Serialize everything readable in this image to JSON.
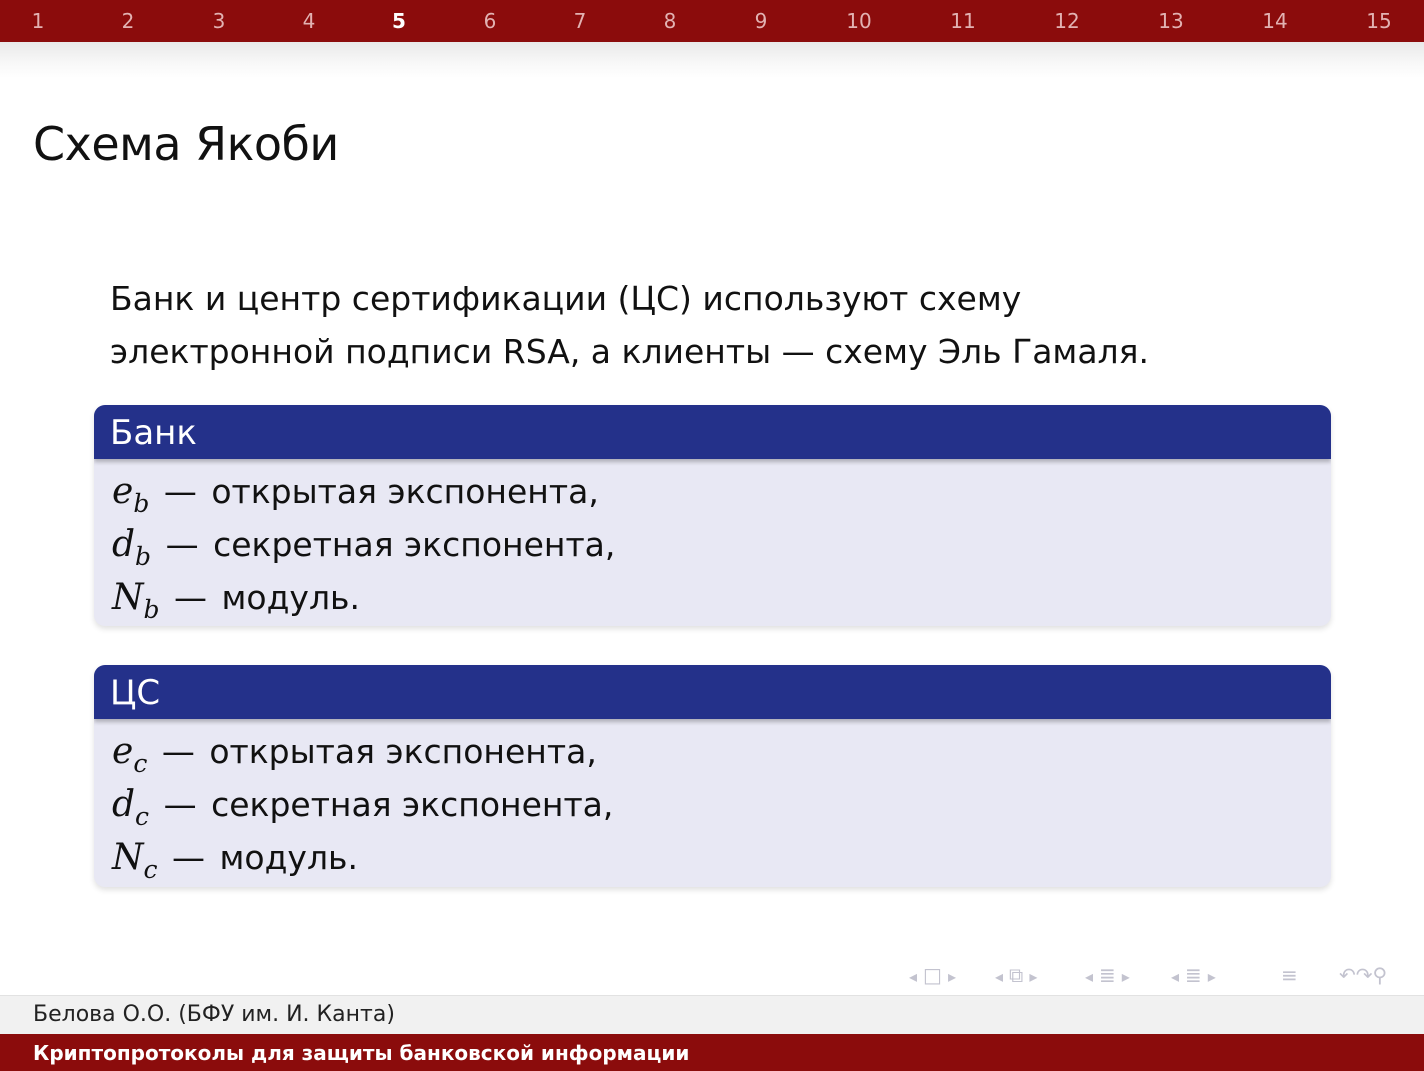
{
  "nav": {
    "pages": [
      "1",
      "2",
      "3",
      "4",
      "5",
      "6",
      "7",
      "8",
      "9",
      "10",
      "11",
      "12",
      "13",
      "14",
      "15"
    ],
    "current": "5"
  },
  "frame": {
    "title": "Схема Якоби",
    "intro": [
      "Банк и центр сертификации (ЦС) используют схему",
      "электронной подписи RSA, а клиенты — схему Эль Гамаля."
    ]
  },
  "blocks": [
    {
      "title": "Банк",
      "rows": [
        {
          "sym": "e",
          "sub": "b",
          "dash": "—",
          "text": "открытая экспонента,"
        },
        {
          "sym": "d",
          "sub": "b",
          "dash": "—",
          "text": "секретная экспонента,"
        },
        {
          "sym": "N",
          "sub": "b",
          "dash": "—",
          "text": "модуль."
        }
      ]
    },
    {
      "title": "ЦС",
      "rows": [
        {
          "sym": "e",
          "sub": "c",
          "dash": "—",
          "text": "открытая экспонента,"
        },
        {
          "sym": "d",
          "sub": "c",
          "dash": "—",
          "text": "секретная экспонента,"
        },
        {
          "sym": "N",
          "sub": "c",
          "dash": "—",
          "text": "модуль."
        }
      ]
    }
  ],
  "navsymbols": {
    "left_arrow": "◂",
    "right_arrow": "▸",
    "frame_icon": "□",
    "subsection_icon": "⧉",
    "section_icon": "≣",
    "doc_icon": "≡",
    "search_icon": "↶↷⚲"
  },
  "footer": {
    "author": "Белова О.О.  (БФУ им. И. Канта)",
    "title": "Криптопротоколы для защиты банковской информации"
  },
  "colors": {
    "nav_bar": "#8b0c0c",
    "block_title": "#24318a",
    "block_body": "#e8e8f4"
  }
}
